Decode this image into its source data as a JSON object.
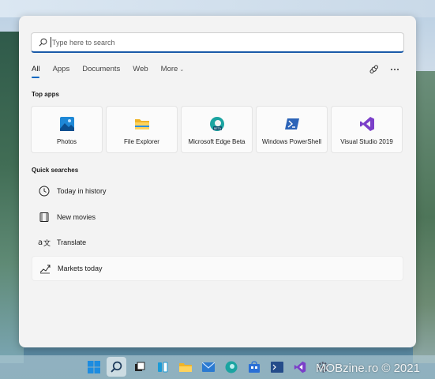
{
  "search": {
    "placeholder": "Type here to search"
  },
  "tabs": [
    {
      "label": "All",
      "active": true
    },
    {
      "label": "Apps"
    },
    {
      "label": "Documents"
    },
    {
      "label": "Web"
    },
    {
      "label": "More"
    }
  ],
  "tools": {
    "share_icon": "share-icon",
    "more_icon": "ellipsis-icon"
  },
  "top_apps": {
    "title": "Top apps",
    "items": [
      {
        "label": "Photos",
        "icon": "photos-icon"
      },
      {
        "label": "File Explorer",
        "icon": "folder-icon"
      },
      {
        "label": "Microsoft Edge Beta",
        "icon": "edge-beta-icon"
      },
      {
        "label": "Windows PowerShell",
        "icon": "powershell-icon"
      },
      {
        "label": "Visual Studio 2019",
        "icon": "visual-studio-icon"
      }
    ]
  },
  "quick_searches": {
    "title": "Quick searches",
    "items": [
      {
        "label": "Today in history",
        "icon": "clock-icon"
      },
      {
        "label": "New movies",
        "icon": "film-icon"
      },
      {
        "label": "Translate",
        "icon": "translate-icon"
      },
      {
        "label": "Markets today",
        "icon": "chart-trend-icon"
      }
    ]
  },
  "taskbar": {
    "icons": [
      "windows-start-icon",
      "search-icon",
      "task-view-icon",
      "widgets-icon",
      "file-explorer-icon",
      "mail-icon",
      "edge-icon",
      "store-icon",
      "terminal-icon",
      "visual-studio-icon",
      "settings-icon"
    ]
  },
  "watermark": "MOBzine.ro © 2021",
  "colors": {
    "accent": "#0067c0",
    "panel": "#f3f3f3"
  }
}
